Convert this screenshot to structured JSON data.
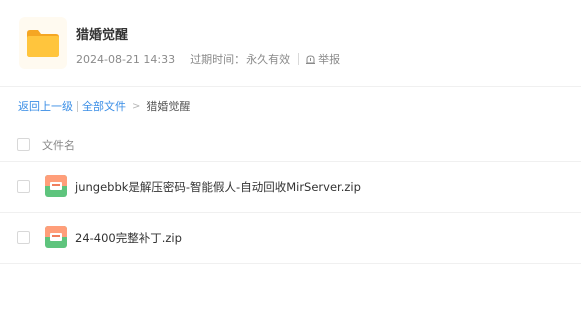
{
  "share": {
    "title": "猎婚觉醒",
    "date": "2024-08-21 14:33",
    "expire_label": "过期时间：",
    "expire_value": "永久有效",
    "report_label": "举报"
  },
  "breadcrumb": {
    "back": "返回上一级",
    "all_files": "全部文件",
    "separator": ">",
    "current": "猎婚觉醒"
  },
  "table": {
    "column_name": "文件名",
    "rows": [
      {
        "name": "jungebbk是解压密码-智能假人-自动回收MirServer.zip",
        "icon": "zip-icon"
      },
      {
        "name": "24-400完整补丁.zip",
        "icon": "zip-icon"
      }
    ]
  },
  "colors": {
    "link": "#3a8ee6",
    "folder": "#ffc53d",
    "zip_top": "#ff9e7a",
    "zip_bottom": "#5ec47d"
  }
}
